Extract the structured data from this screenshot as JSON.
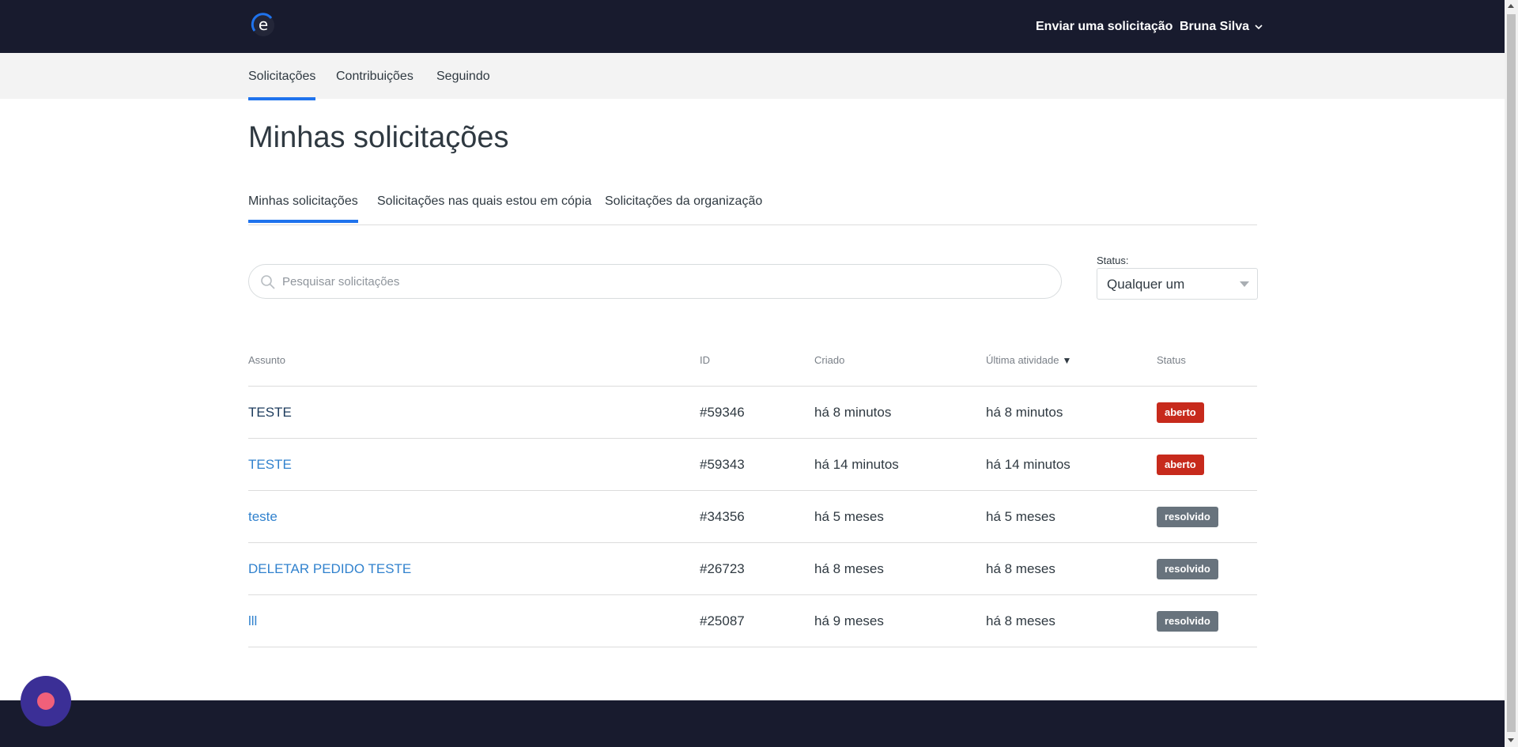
{
  "header": {
    "logo_letter": "e",
    "submit_request": "Enviar uma solicitação",
    "user_name": "Bruna Silva"
  },
  "subnav": {
    "tabs": [
      {
        "label": "Solicitações",
        "active": true
      },
      {
        "label": "Contribuições",
        "active": false
      },
      {
        "label": "Seguindo",
        "active": false
      }
    ]
  },
  "page": {
    "title": "Minhas solicitações"
  },
  "request_tabs": [
    {
      "label": "Minhas solicitações",
      "active": true
    },
    {
      "label": "Solicitações nas quais estou em cópia",
      "active": false
    },
    {
      "label": "Solicitações da organização",
      "active": false
    }
  ],
  "search": {
    "placeholder": "Pesquisar solicitações"
  },
  "status_filter": {
    "label": "Status:",
    "selected": "Qualquer um"
  },
  "table": {
    "headers": {
      "subject": "Assunto",
      "id": "ID",
      "created": "Criado",
      "last_activity": "Última atividade",
      "last_activity_sort": "▼",
      "status": "Status"
    },
    "rows": [
      {
        "subject": "TESTE",
        "id": "#59346",
        "created": "há 8 minutos",
        "last_activity": "há 8 minutos",
        "status": "aberto",
        "status_kind": "open",
        "visited": true
      },
      {
        "subject": "TESTE",
        "id": "#59343",
        "created": "há 14 minutos",
        "last_activity": "há 14 minutos",
        "status": "aberto",
        "status_kind": "open",
        "visited": false
      },
      {
        "subject": "teste",
        "id": "#34356",
        "created": "há 5 meses",
        "last_activity": "há 5 meses",
        "status": "resolvido",
        "status_kind": "solved",
        "visited": false
      },
      {
        "subject": "DELETAR PEDIDO TESTE",
        "id": "#26723",
        "created": "há 8 meses",
        "last_activity": "há 8 meses",
        "status": "resolvido",
        "status_kind": "solved",
        "visited": false
      },
      {
        "subject": "lll",
        "id": "#25087",
        "created": "há 9 meses",
        "last_activity": "há 8 meses",
        "status": "resolvido",
        "status_kind": "solved",
        "visited": false
      }
    ]
  },
  "colors": {
    "header_bg": "#181b2e",
    "accent": "#1f73ed",
    "open_badge": "#c72a1c",
    "solved_badge": "#68737d",
    "launcher_bg": "#3b2f96",
    "launcher_dot": "#f0607a"
  },
  "icons": {
    "logo": "e-logo-icon",
    "user_menu": "chevron-down-icon",
    "search": "search-icon",
    "status_select": "caret-down-icon",
    "launcher": "chat-launcher-icon"
  }
}
